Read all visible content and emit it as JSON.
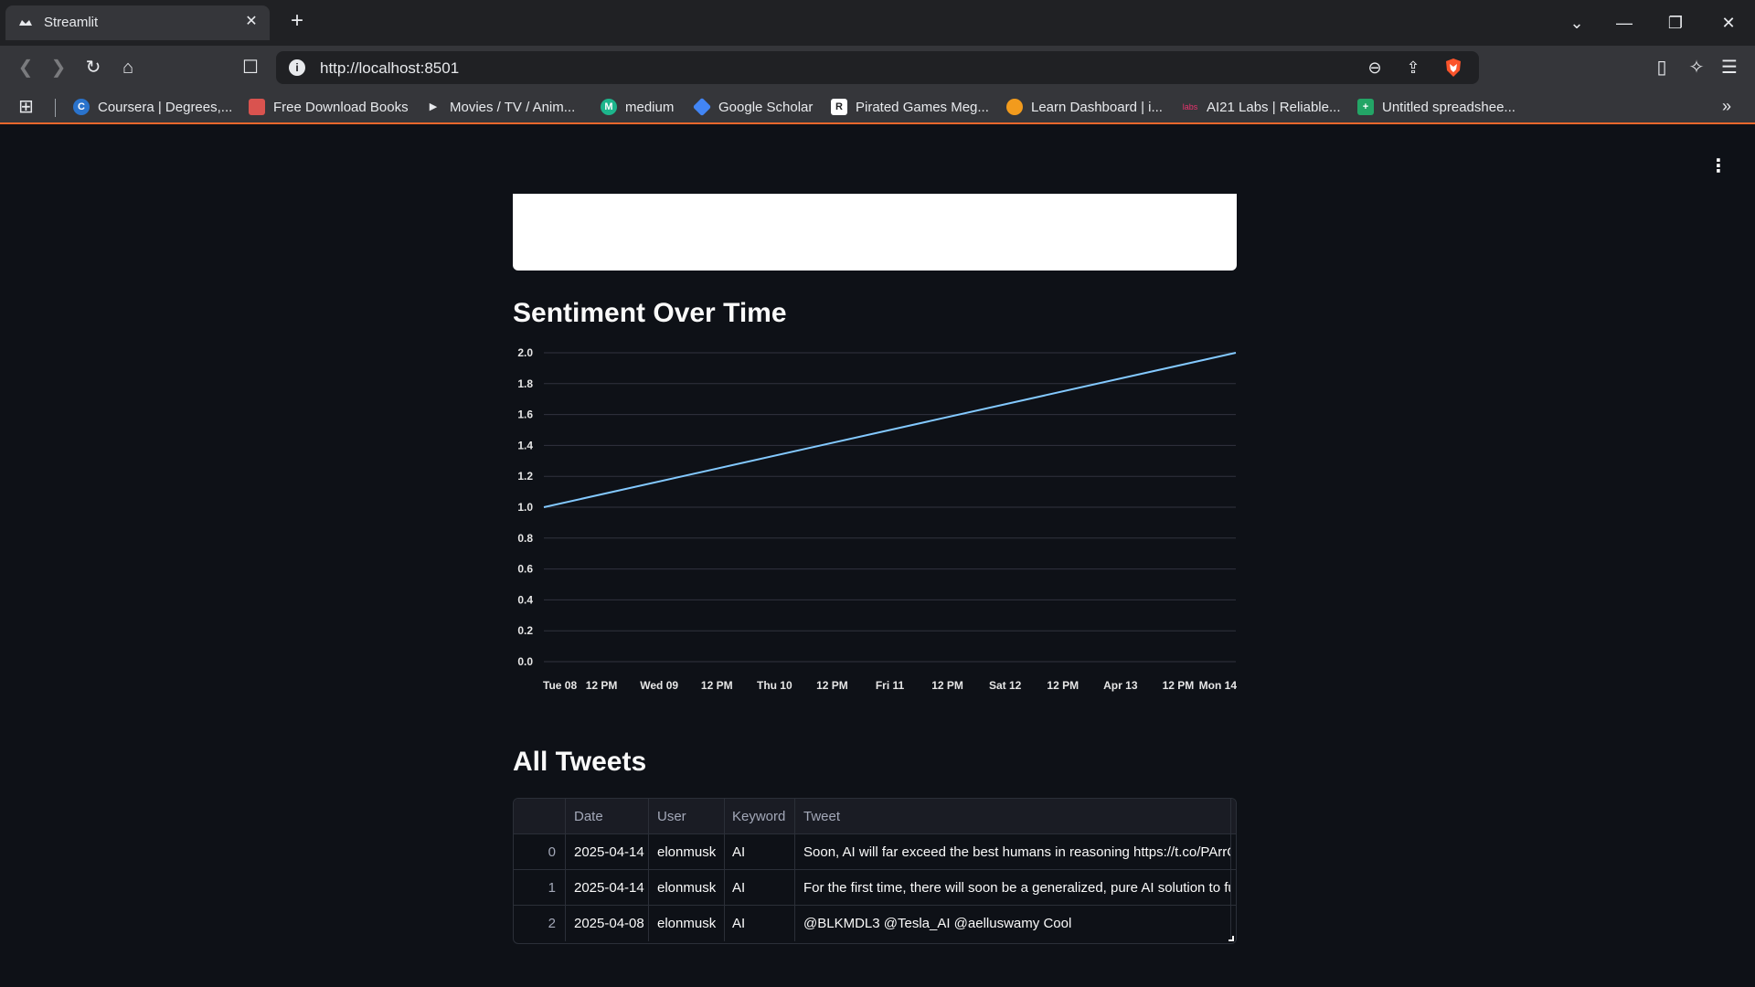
{
  "browser": {
    "tab_title": "Streamlit",
    "url": "http://localhost:8501",
    "bookmarks": [
      {
        "label": "Coursera | Degrees,...",
        "icon": "coursera-icon",
        "color": "#2a73cc"
      },
      {
        "label": "Free Download Books",
        "icon": "book-icon",
        "color": "#d9534f"
      },
      {
        "label": "Movies / TV / Anim...",
        "icon": "play-icon",
        "color": "#e8eaed"
      },
      {
        "label": "medium",
        "icon": "medium-icon",
        "color": "#1db58c"
      },
      {
        "label": "Google Scholar",
        "icon": "scholar-icon",
        "color": "#4285f4"
      },
      {
        "label": "Pirated Games Meg...",
        "icon": "games-icon",
        "color": "#ffffff"
      },
      {
        "label": "Learn Dashboard | i...",
        "icon": "learn-icon",
        "color": "#f29b1d"
      },
      {
        "label": "AI21 Labs | Reliable...",
        "icon": "ai21-icon",
        "color": "#e8336d"
      },
      {
        "label": "Untitled spreadshee...",
        "icon": "sheets-icon",
        "color": "#23a566"
      }
    ]
  },
  "page": {
    "chart_title": "Sentiment Over Time",
    "table_title": "All Tweets"
  },
  "chart_data": {
    "type": "line",
    "x_tick_labels": [
      "Tue 08",
      "12 PM",
      "Wed 09",
      "12 PM",
      "Thu 10",
      "12 PM",
      "Fri 11",
      "12 PM",
      "Sat 12",
      "12 PM",
      "Apr 13",
      "12 PM",
      "Mon 14"
    ],
    "y_tick_labels": [
      "0.0",
      "0.2",
      "0.4",
      "0.6",
      "0.8",
      "1.0",
      "1.2",
      "1.4",
      "1.6",
      "1.8",
      "2.0"
    ],
    "ylim": [
      0,
      2
    ],
    "x": [
      "2025-04-08",
      "2025-04-14"
    ],
    "y": [
      1.0,
      2.0
    ],
    "grid": true,
    "line_color": "#83c9ff"
  },
  "table": {
    "columns": [
      "",
      "Date",
      "User",
      "Keyword",
      "Tweet"
    ],
    "rows": [
      [
        "0",
        "2025-04-14",
        "elonmusk",
        "AI",
        "Soon, AI will far exceed the best humans in reasoning https://t.co/PArrO"
      ],
      [
        "1",
        "2025-04-14",
        "elonmusk",
        "AI",
        "For the first time, there will soon be a generalized, pure AI solution to ful"
      ],
      [
        "2",
        "2025-04-08",
        "elonmusk",
        "AI",
        "@BLKMDL3 @Tesla_AI @aelluswamy Cool"
      ]
    ]
  }
}
